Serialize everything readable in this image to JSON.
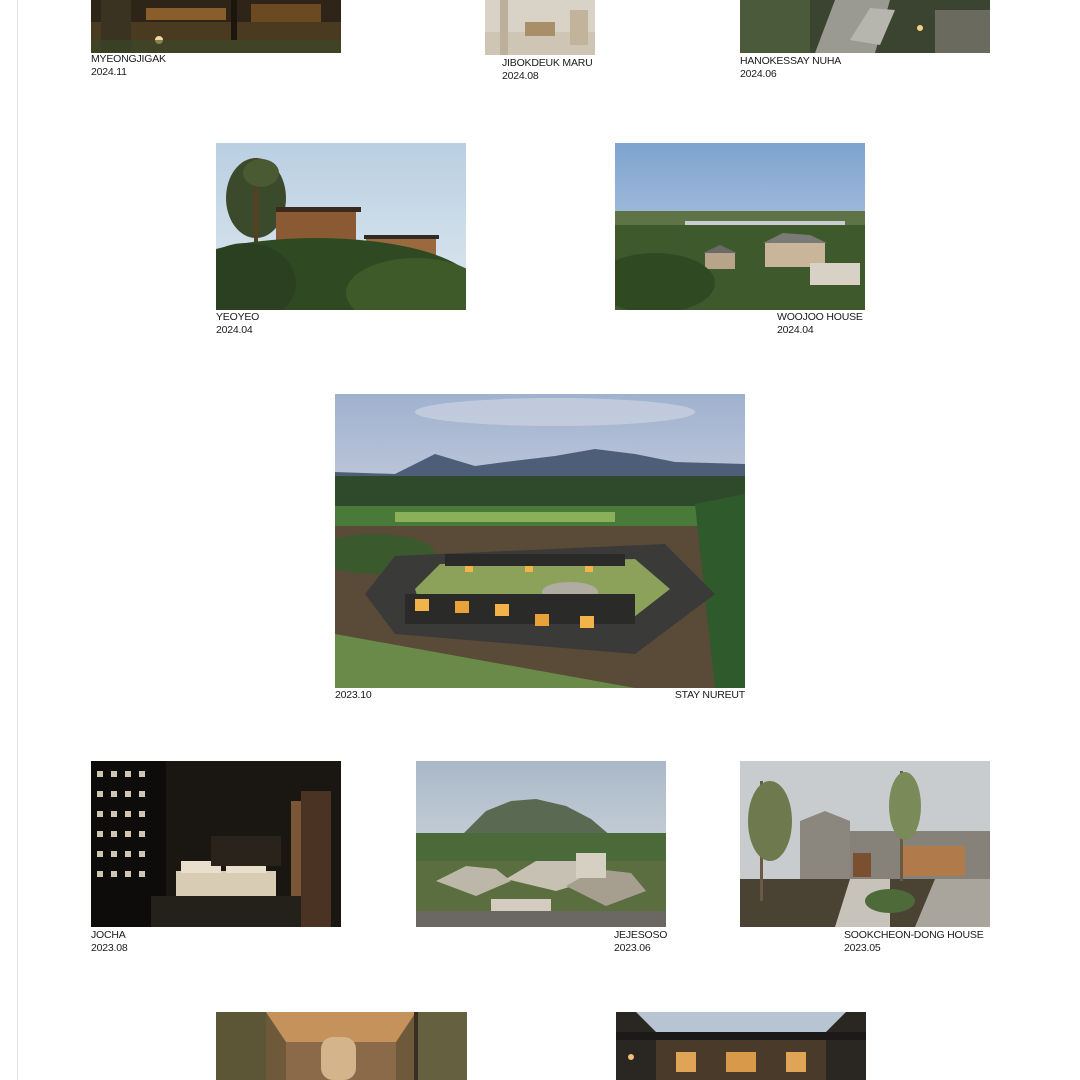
{
  "projects": [
    {
      "name": "MYEONGJIGAK",
      "date": "2024.11"
    },
    {
      "name": "JIBOKDEUK MARU",
      "date": "2024.08"
    },
    {
      "name": "HANOKESSAY NUHA",
      "date": "2024.06"
    },
    {
      "name": "YEOYEO",
      "date": "2024.04"
    },
    {
      "name": "WOOJOO HOUSE",
      "date": "2024.04"
    },
    {
      "name": "STAY NUREUT",
      "date": "2023.10"
    },
    {
      "name": "JOCHA",
      "date": "2023.08"
    },
    {
      "name": "JEJESOSO",
      "date": "2023.06"
    },
    {
      "name": "SOOKCHEON-DONG HOUSE",
      "date": "2023.05"
    },
    {
      "name": "",
      "date": ""
    },
    {
      "name": "",
      "date": ""
    }
  ]
}
